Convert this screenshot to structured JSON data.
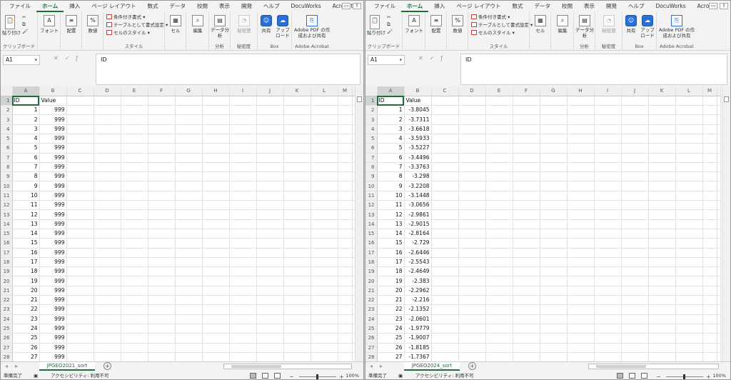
{
  "ribbon_tabs": [
    "ファイル",
    "ホーム",
    "挿入",
    "ページ レイアウト",
    "数式",
    "データ",
    "校閲",
    "表示",
    "開発",
    "ヘルプ",
    "DocuWorks",
    "Acrobat"
  ],
  "ribbon": {
    "paste": "貼り付け",
    "clipboard": "クリップボード",
    "font": "フォント",
    "alignment": "配置",
    "number": "数値",
    "cond_format": "条件付き書式",
    "table_format": "テーブルとして書式設定",
    "cell_style": "セルのスタイル",
    "style_group": "スタイル",
    "cells": "セル",
    "editing": "編集",
    "analyze": "データ分析",
    "analyze_group": "分析",
    "sensitivity": "秘密度",
    "sensitivity_group": "秘密度",
    "share": "共有",
    "upload": "アップロード",
    "box_group": "Box",
    "adobe_pdf": "Adobe PDF の作成および共有",
    "adobe_group": "Adobe Acrobat"
  },
  "status": {
    "ready": "準備完了",
    "accessibility": "アクセシビリティ: 利用不可",
    "zoom": "100%"
  },
  "left": {
    "name_box": "A1",
    "formula": "ID",
    "sheet_tab": "JPGEO2021_sort",
    "columns": [
      "A",
      "B",
      "C",
      "D",
      "E",
      "F",
      "G",
      "H",
      "I",
      "J",
      "K",
      "L",
      "M"
    ],
    "headers": [
      "ID",
      "Value"
    ],
    "rows": [
      [
        1,
        "999"
      ],
      [
        2,
        "999"
      ],
      [
        3,
        "999"
      ],
      [
        4,
        "999"
      ],
      [
        5,
        "999"
      ],
      [
        6,
        "999"
      ],
      [
        7,
        "999"
      ],
      [
        8,
        "999"
      ],
      [
        9,
        "999"
      ],
      [
        10,
        "999"
      ],
      [
        11,
        "999"
      ],
      [
        12,
        "999"
      ],
      [
        13,
        "999"
      ],
      [
        14,
        "999"
      ],
      [
        15,
        "999"
      ],
      [
        16,
        "999"
      ],
      [
        17,
        "999"
      ],
      [
        18,
        "999"
      ],
      [
        19,
        "999"
      ],
      [
        20,
        "999"
      ],
      [
        21,
        "999"
      ],
      [
        22,
        "999"
      ],
      [
        23,
        "999"
      ],
      [
        24,
        "999"
      ],
      [
        25,
        "999"
      ],
      [
        26,
        "999"
      ],
      [
        27,
        "999"
      ]
    ]
  },
  "right": {
    "name_box": "A1",
    "formula": "ID",
    "sheet_tab": "JPGEO2024_sort",
    "columns": [
      "A",
      "B",
      "C",
      "D",
      "E",
      "F",
      "G",
      "H",
      "I",
      "J",
      "K",
      "L",
      "M"
    ],
    "headers": [
      "ID",
      "Value"
    ],
    "rows": [
      [
        1,
        "-3.8045"
      ],
      [
        2,
        "-3.7311"
      ],
      [
        3,
        "-3.6618"
      ],
      [
        4,
        "-3.5933"
      ],
      [
        5,
        "-3.5227"
      ],
      [
        6,
        "-3.4496"
      ],
      [
        7,
        "-3.3763"
      ],
      [
        8,
        "-3.298"
      ],
      [
        9,
        "-3.2208"
      ],
      [
        10,
        "-3.1448"
      ],
      [
        11,
        "-3.0656"
      ],
      [
        12,
        "-2.9861"
      ],
      [
        13,
        "-2.9015"
      ],
      [
        14,
        "-2.8164"
      ],
      [
        15,
        "-2.729"
      ],
      [
        16,
        "-2.6446"
      ],
      [
        17,
        "-2.5543"
      ],
      [
        18,
        "-2.4649"
      ],
      [
        19,
        "-2.383"
      ],
      [
        20,
        "-2.2962"
      ],
      [
        21,
        "-2.216"
      ],
      [
        22,
        "-2.1352"
      ],
      [
        23,
        "-2.0601"
      ],
      [
        24,
        "-1.9779"
      ],
      [
        25,
        "-1.9007"
      ],
      [
        26,
        "-1.8185"
      ],
      [
        27,
        "-1.7367"
      ]
    ]
  }
}
